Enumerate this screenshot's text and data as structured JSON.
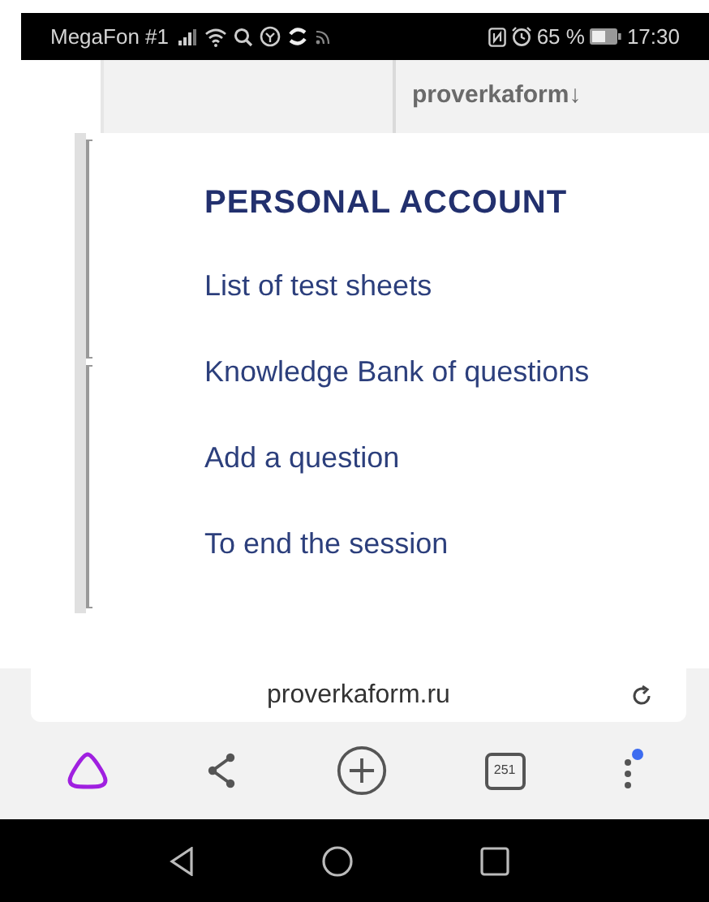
{
  "status_bar": {
    "carrier": "MegaFon #1",
    "battery": "65 %",
    "time": "17:30"
  },
  "site_header": {
    "title": "proverkaform↓"
  },
  "menu": {
    "heading": "PERSONAL ACCOUNT",
    "items": [
      {
        "label": "List of test sheets"
      },
      {
        "label": "Knowledge Bank of questions"
      },
      {
        "label": "Add a question"
      },
      {
        "label": "To end the session"
      }
    ]
  },
  "address_bar": {
    "url": "proverkaform.ru"
  },
  "toolbar": {
    "tab_count": "251"
  }
}
